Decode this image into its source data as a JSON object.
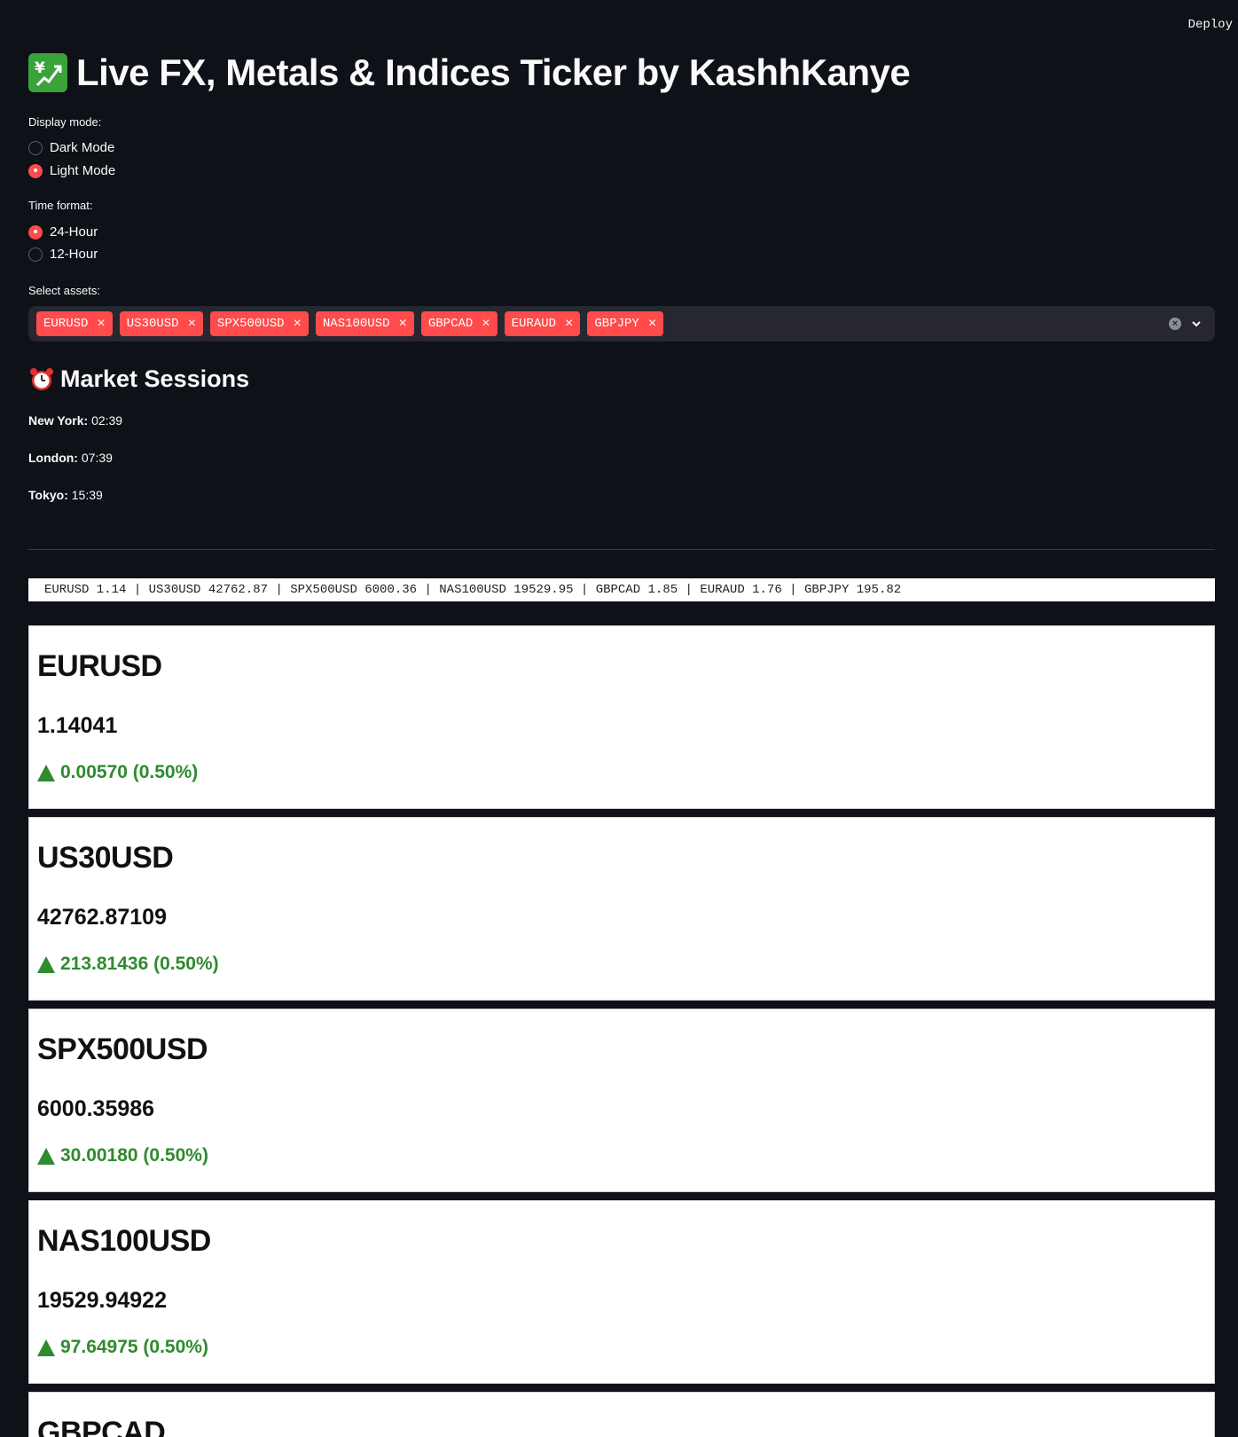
{
  "header": {
    "deploy_label": "Deploy"
  },
  "title": {
    "text": "Live FX, Metals & Indices Ticker by KashhKanye",
    "icon": "chart-yen-icon"
  },
  "display_mode": {
    "label": "Display mode:",
    "options": [
      {
        "label": "Dark Mode",
        "checked": false
      },
      {
        "label": "Light Mode",
        "checked": true
      }
    ]
  },
  "time_format": {
    "label": "Time format:",
    "options": [
      {
        "label": "24-Hour",
        "checked": true
      },
      {
        "label": "12-Hour",
        "checked": false
      }
    ]
  },
  "assets": {
    "label": "Select assets:",
    "selected": [
      "EURUSD",
      "US30USD",
      "SPX500USD",
      "NAS100USD",
      "GBPCAD",
      "EURAUD",
      "GBPJPY"
    ],
    "chip_close": "×"
  },
  "sessions": {
    "title": "Market Sessions",
    "icon": "alarm-clock-icon",
    "items": [
      {
        "city": "New York:",
        "time": "02:39"
      },
      {
        "city": "London:",
        "time": "07:39"
      },
      {
        "city": "Tokyo:",
        "time": "15:39"
      }
    ]
  },
  "ticker": {
    "text": "EURUSD 1.14 | US30USD 42762.87 | SPX500USD 6000.36 | NAS100USD 19529.95 | GBPCAD 1.85 | EURAUD 1.76 | GBPJPY 195.82"
  },
  "cards": [
    {
      "name": "EURUSD",
      "price": "1.14041",
      "change": "0.00570 (0.50%)"
    },
    {
      "name": "US30USD",
      "price": "42762.87109",
      "change": "213.81436 (0.50%)"
    },
    {
      "name": "SPX500USD",
      "price": "6000.35986",
      "change": "30.00180 (0.50%)"
    },
    {
      "name": "NAS100USD",
      "price": "19529.94922",
      "change": "97.64975 (0.50%)"
    },
    {
      "name": "GBPCAD",
      "price": "",
      "change": ""
    }
  ],
  "colors": {
    "accent": "#ff4b4b",
    "up": "#2e8b2e",
    "background": "#0e1117"
  }
}
